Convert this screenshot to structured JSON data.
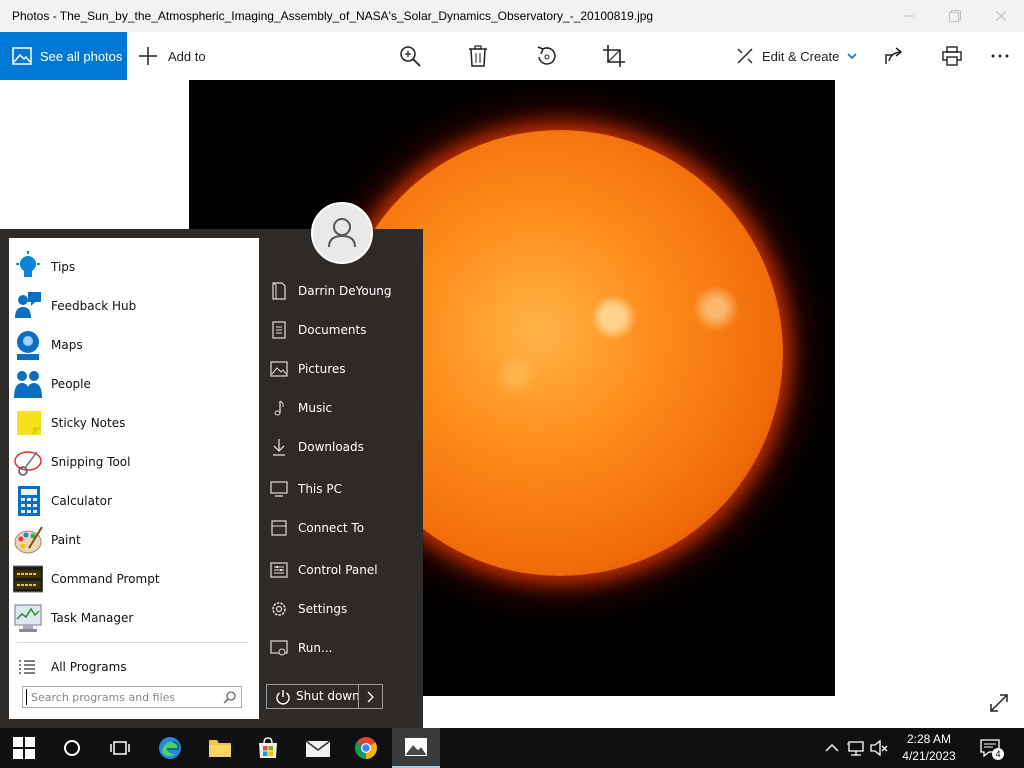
{
  "window": {
    "title": "Photos - The_Sun_by_the_Atmospheric_Imaging_Assembly_of_NASA's_Solar_Dynamics_Observatory_-_20100819.jpg"
  },
  "toolbar": {
    "see_all_photos": "See all photos",
    "add_to": "Add to",
    "edit_create": "Edit & Create",
    "accent": "#0078d4"
  },
  "start_menu": {
    "apps": [
      {
        "label": "Tips",
        "icon": "tips-icon"
      },
      {
        "label": "Feedback Hub",
        "icon": "feedback-hub-icon"
      },
      {
        "label": "Maps",
        "icon": "maps-icon"
      },
      {
        "label": "People",
        "icon": "people-icon"
      },
      {
        "label": "Sticky Notes",
        "icon": "sticky-notes-icon"
      },
      {
        "label": "Snipping Tool",
        "icon": "snipping-tool-icon"
      },
      {
        "label": "Calculator",
        "icon": "calculator-icon"
      },
      {
        "label": "Paint",
        "icon": "paint-icon"
      },
      {
        "label": "Command Prompt",
        "icon": "command-prompt-icon"
      },
      {
        "label": "Task Manager",
        "icon": "task-manager-icon"
      }
    ],
    "all_programs": "All Programs",
    "search_placeholder": "Search programs and files",
    "places": [
      {
        "label": "Darrin DeYoung",
        "icon": "user-folder-icon"
      },
      {
        "label": "Documents",
        "icon": "documents-icon"
      },
      {
        "label": "Pictures",
        "icon": "pictures-icon"
      },
      {
        "label": "Music",
        "icon": "music-icon"
      },
      {
        "label": "Downloads",
        "icon": "downloads-icon"
      },
      {
        "label": "This PC",
        "icon": "this-pc-icon"
      },
      {
        "label": "Connect To",
        "icon": "connect-to-icon"
      },
      {
        "label": "Control Panel",
        "icon": "control-panel-icon"
      },
      {
        "label": "Settings",
        "icon": "settings-icon"
      },
      {
        "label": "Run...",
        "icon": "run-icon"
      }
    ],
    "shutdown": "Shut down"
  },
  "taskbar": {
    "time": "2:28 AM",
    "date": "4/21/2023",
    "notification_count": "4"
  }
}
